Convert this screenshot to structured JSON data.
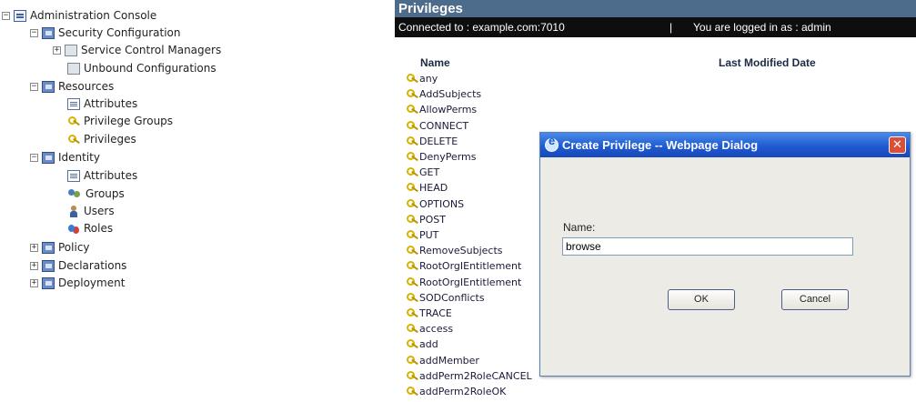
{
  "tree": {
    "root": {
      "label": "Administration Console",
      "toggle": "−"
    },
    "security": {
      "label": "Security Configuration",
      "toggle": "−"
    },
    "scm": {
      "label": "Service Control Managers",
      "toggle": "+"
    },
    "unbound": {
      "label": "Unbound Configurations"
    },
    "resources": {
      "label": "Resources",
      "toggle": "−"
    },
    "res_attributes": {
      "label": "Attributes"
    },
    "privilege_groups": {
      "label": "Privilege Groups"
    },
    "privileges": {
      "label": "Privileges"
    },
    "identity": {
      "label": "Identity",
      "toggle": "−"
    },
    "id_attributes": {
      "label": "Attributes"
    },
    "groups": {
      "label": "Groups"
    },
    "users": {
      "label": "Users"
    },
    "roles": {
      "label": "Roles"
    },
    "policy": {
      "label": "Policy",
      "toggle": "+"
    },
    "declarations": {
      "label": "Declarations",
      "toggle": "+"
    },
    "deployment": {
      "label": "Deployment",
      "toggle": "+"
    }
  },
  "panel": {
    "title": "Privileges",
    "connected": "Connected to : example.com:7010",
    "separator": "|",
    "logged_in": "You are logged in as : admin",
    "col_name": "Name",
    "col_date": "Last Modified Date",
    "rows": [
      "any",
      "AddSubjects",
      "AllowPerms",
      "CONNECT",
      "DELETE",
      "DenyPerms",
      "GET",
      "HEAD",
      "OPTIONS",
      "POST",
      "PUT",
      "RemoveSubjects",
      "RootOrgIEntitlement",
      "RootOrgIEntitlement",
      "SODConflicts",
      "TRACE",
      "access",
      "add",
      "addMember",
      "addPerm2RoleCANCEL",
      "addPerm2RoleOK"
    ]
  },
  "dialog": {
    "title": "Create Privilege -- Webpage Dialog",
    "close": "✕",
    "name_label": "Name:",
    "name_value": "browse",
    "ok": "OK",
    "cancel": "Cancel"
  },
  "colors": {
    "panel_title_bg": "#4d6b8a",
    "statusbar_bg": "#0e0e0e",
    "dialog_title_bg": "#1f5bd2",
    "dialog_close_bg": "#d9503a",
    "key_icon": "#d8b200"
  }
}
